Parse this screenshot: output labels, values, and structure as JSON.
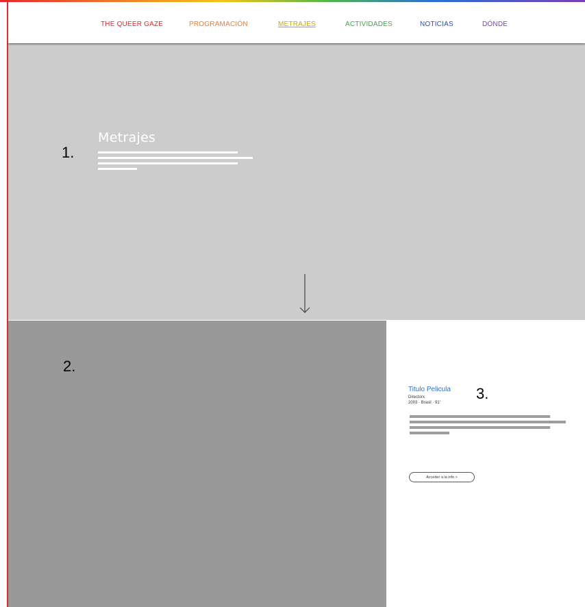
{
  "nav": {
    "items": [
      {
        "label": "THE QUEER GAZE",
        "color": "#e8262b"
      },
      {
        "label": "PROGRAMACIÓN",
        "color": "#f07b2a"
      },
      {
        "label": "METRAJES",
        "color": "#c9a800",
        "active": true
      },
      {
        "label": "ACTIVIDADES",
        "color": "#3ea44a"
      },
      {
        "label": "NOTICIAS",
        "color": "#2a4fb0"
      },
      {
        "label": "DÓNDE",
        "color": "#7b3fb8"
      }
    ]
  },
  "hero": {
    "title": "Metrajes"
  },
  "annotations": {
    "one": "1.",
    "two": "2.",
    "three": "3."
  },
  "film": {
    "title": "Titulo Pelicula",
    "director": "Directorx",
    "details": "2003 · Brasil · 91'",
    "button_label": "Acceder a la info >"
  },
  "colors": {
    "hero_bg": "#cccccc",
    "image_placeholder_bg": "#999999",
    "film_title": "#2a6fd6",
    "left_border": "#e8262b"
  }
}
